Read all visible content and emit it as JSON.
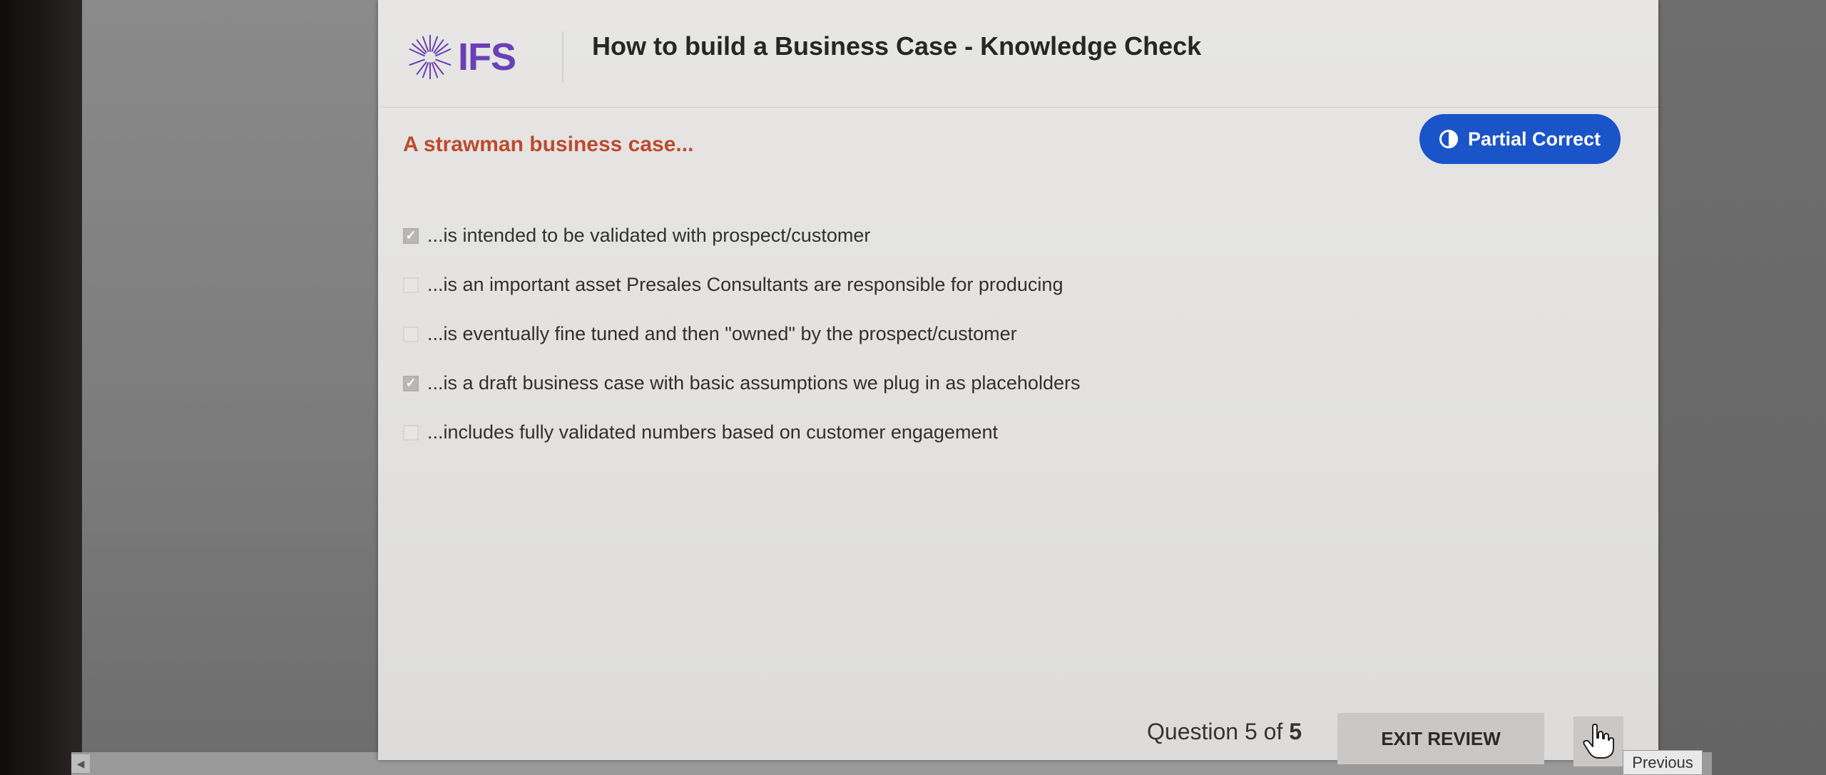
{
  "header": {
    "logo_text": "IFS",
    "title": "How to build a Business Case - Knowledge Check"
  },
  "question": {
    "prompt": "A strawman business case...",
    "result_badge": "Partial Correct",
    "options": [
      {
        "label": "...is intended to be validated with prospect/customer",
        "checked": true
      },
      {
        "label": "...is an important asset Presales Consultants are responsible for producing",
        "checked": false
      },
      {
        "label": "...is eventually fine tuned and then \"owned\" by the prospect/customer",
        "checked": false
      },
      {
        "label": "...is a draft business case with basic assumptions we plug in as placeholders",
        "checked": true
      },
      {
        "label": "...includes fully validated numbers based on customer engagement",
        "checked": false
      }
    ]
  },
  "footer": {
    "progress_prefix": "Question 5 of",
    "progress_total": "5",
    "exit_label": "EXIT REVIEW",
    "previous_tooltip": "Previous"
  },
  "colors": {
    "brand": "#6b3fb8",
    "question": "#bd4a2e",
    "badge": "#1a54c9"
  }
}
